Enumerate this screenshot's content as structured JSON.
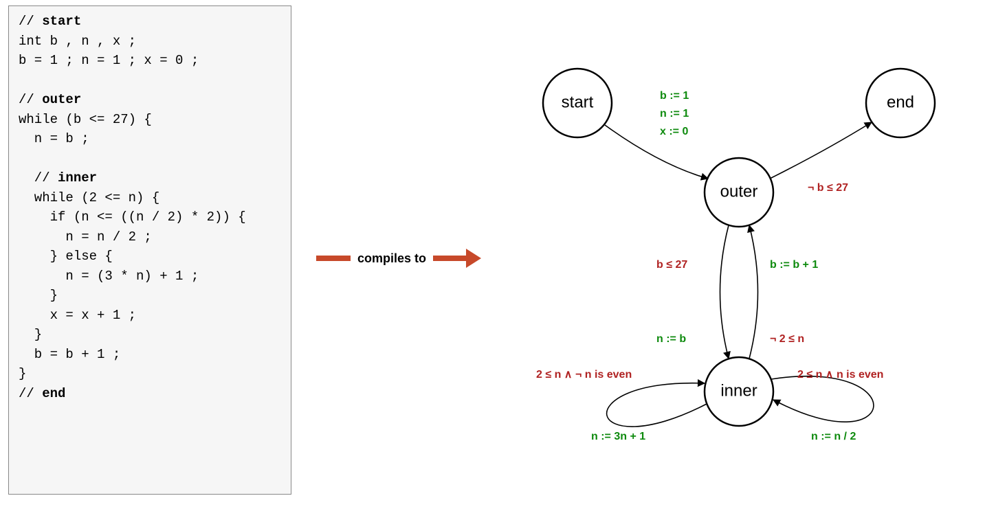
{
  "code": {
    "l1": "// ",
    "l1b": "start",
    "l2": "int b , n , x ;",
    "l3": "b = 1 ; n = 1 ; x = 0 ;",
    "l4": "",
    "l5": "// ",
    "l5b": "outer",
    "l6": "while (b <= 27) {",
    "l7": "  n = b ;",
    "l8": "",
    "l9": "  // ",
    "l9b": "inner",
    "l10": "  while (2 <= n) {",
    "l11": "    if (n <= ((n / 2) * 2)) {",
    "l12": "      n = n / 2 ;",
    "l13": "    } else {",
    "l14": "      n = (3 * n) + 1 ;",
    "l15": "    }",
    "l16": "    x = x + 1 ;",
    "l17": "  }",
    "l18": "  b = b + 1 ;",
    "l19": "}",
    "l20": "// ",
    "l20b": "end"
  },
  "compiles_label": "compiles to",
  "nodes": {
    "start": "start",
    "end": "end",
    "outer": "outer",
    "inner": "inner"
  },
  "edges": {
    "start_outer_1": "b := 1",
    "start_outer_2": "n := 1",
    "start_outer_3": "x := 0",
    "outer_end": "¬ b ≤ 27",
    "outer_inner_guard": "b ≤ 27",
    "outer_inner_act": "n := b",
    "inner_outer_guard": "¬ 2 ≤ n",
    "inner_outer_act": "b := b + 1",
    "left_loop_guard": "2 ≤ n ∧ ¬ n is even",
    "left_loop_act": "n := 3n + 1",
    "right_loop_guard": "2 ≤ n ∧ n is even",
    "right_loop_act": "n := n / 2"
  }
}
